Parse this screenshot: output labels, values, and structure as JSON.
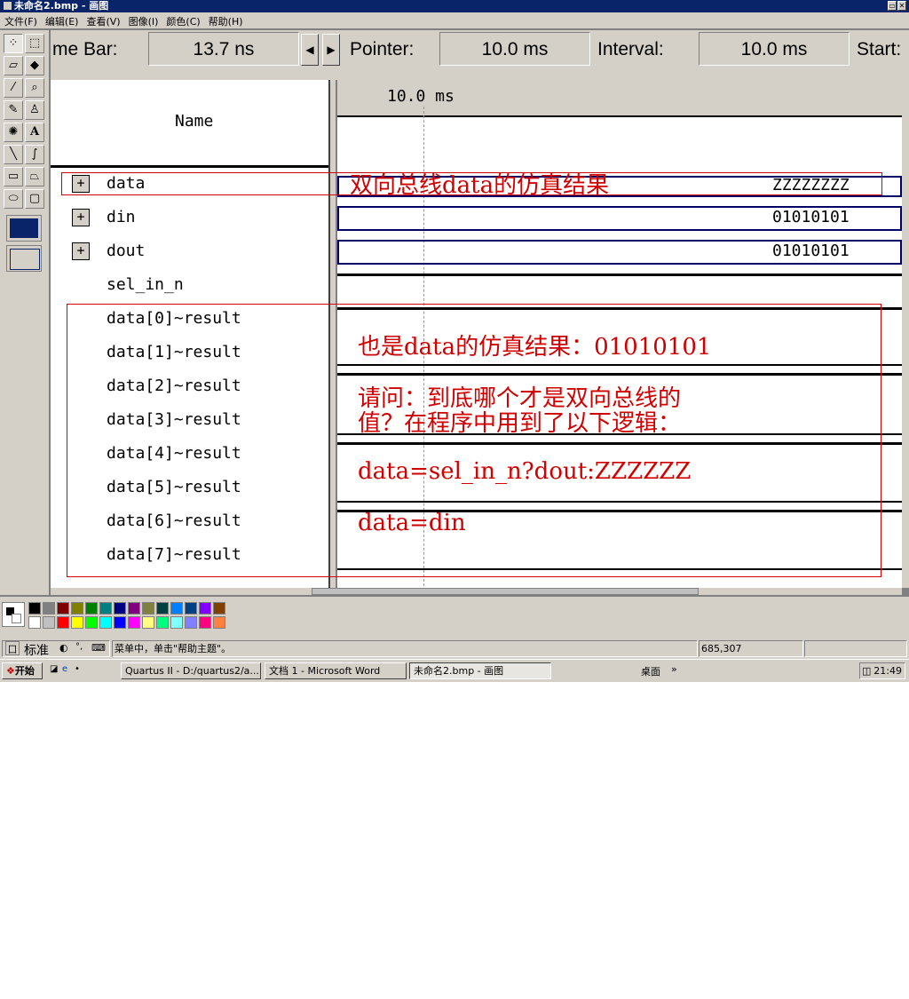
{
  "window": {
    "title": "未命名2.bmp - 画图"
  },
  "menu": [
    "文件(F)",
    "编辑(E)",
    "查看(V)",
    "图像(I)",
    "颜色(C)",
    "帮助(H)"
  ],
  "quartus_bar": {
    "time_bar_label": "me Bar:",
    "time_bar_value": "13.7 ns",
    "pointer_label": "Pointer:",
    "pointer_value": "10.0 ms",
    "interval_label": "Interval:",
    "interval_value": "10.0 ms",
    "start_label": "Start:"
  },
  "name_header": "Name",
  "time_marker": "10.0 ms",
  "signals": [
    {
      "name": "data",
      "expandable": true,
      "value": "ZZZZZZZZ"
    },
    {
      "name": "din",
      "expandable": true,
      "value": "01010101"
    },
    {
      "name": "dout",
      "expandable": true,
      "value": "01010101"
    },
    {
      "name": "sel_in_n",
      "expandable": false,
      "value": ""
    },
    {
      "name": "data[0]~result",
      "expandable": false,
      "value": ""
    },
    {
      "name": "data[1]~result",
      "expandable": false,
      "value": ""
    },
    {
      "name": "data[2]~result",
      "expandable": false,
      "value": ""
    },
    {
      "name": "data[3]~result",
      "expandable": false,
      "value": ""
    },
    {
      "name": "data[4]~result",
      "expandable": false,
      "value": ""
    },
    {
      "name": "data[5]~result",
      "expandable": false,
      "value": ""
    },
    {
      "name": "data[6]~result",
      "expandable": false,
      "value": ""
    },
    {
      "name": "data[7]~result",
      "expandable": false,
      "value": ""
    }
  ],
  "annotations": {
    "a1": "双向总线data的仿真结果",
    "a2": "也是data的仿真结果：01010101",
    "a3_line1": "请问：到底哪个才是双向总线的",
    "a3_line2": "值？在程序中用到了以下逻辑：",
    "a4": "data=sel_in_n?dout:ZZZZZZ",
    "a5": "data=din"
  },
  "status": {
    "help_text": "菜单中，单击\"帮助主题\"。",
    "coords": "685,307",
    "ime_label": "标准"
  },
  "taskbar": {
    "start": "开始",
    "tasks": [
      "Quartus II - D:/quartus2/a...",
      "文档 1 - Microsoft Word",
      "未命名2.bmp - 画图"
    ],
    "desktop": "桌面",
    "clock": "21:49"
  },
  "colors": {
    "annotation": "#d10000",
    "titlebar": "#0a246a",
    "palette": [
      "#000000",
      "#808080",
      "#800000",
      "#808000",
      "#008000",
      "#008080",
      "#000080",
      "#800080",
      "#808040",
      "#004040",
      "#0080ff",
      "#004080",
      "#8000ff",
      "#804000",
      "#ffffff",
      "#c0c0c0",
      "#ff0000",
      "#ffff00",
      "#00ff00",
      "#00ffff",
      "#0000ff",
      "#ff00ff",
      "#ffff80",
      "#00ff80",
      "#80ffff",
      "#8080ff",
      "#ff0080",
      "#ff8040"
    ]
  }
}
